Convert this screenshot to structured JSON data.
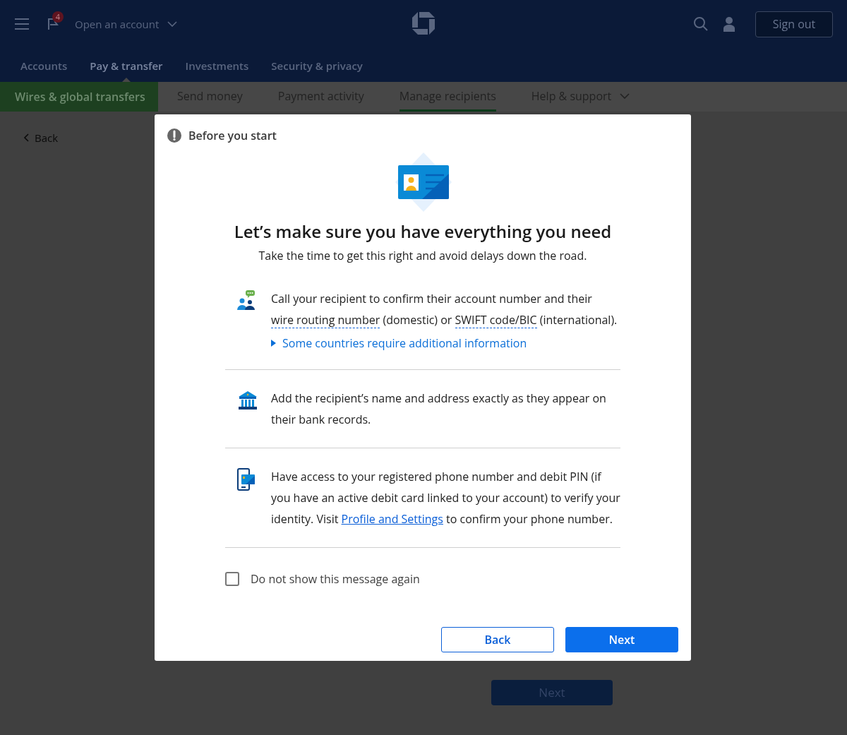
{
  "header": {
    "notification_count": "4",
    "open_account": "Open an account",
    "sign_out": "Sign out"
  },
  "main_nav": [
    {
      "label": "Accounts",
      "selected": false
    },
    {
      "label": "Pay & transfer",
      "selected": true
    },
    {
      "label": "Investments",
      "selected": false
    },
    {
      "label": "Security & privacy",
      "selected": false
    }
  ],
  "sub_nav": {
    "section": "Wires & global transfers",
    "items": [
      {
        "label": "Send money",
        "selected": false,
        "kind": "link"
      },
      {
        "label": "Payment activity",
        "selected": false,
        "kind": "link"
      },
      {
        "label": "Manage recipients",
        "selected": true,
        "kind": "link"
      },
      {
        "label": "Help & support",
        "selected": false,
        "kind": "menu"
      }
    ]
  },
  "back_link": "Back",
  "page_button": "Next",
  "dialog": {
    "title": "Before you start",
    "heading": "Let’s make sure you have everything you need",
    "subheading": "Take the time to get this right and avoid delays down the road.",
    "items": [
      {
        "kind": "people",
        "segments": [
          {
            "kind": "plain",
            "text": "Call your recipient to confirm their account number and their "
          },
          {
            "kind": "term",
            "text": "wire routing number"
          },
          {
            "kind": "plain",
            "text": " (domestic)  or "
          },
          {
            "kind": "term",
            "text": "SWIFT code/BIC"
          },
          {
            "kind": "plain",
            "text": " (international)."
          }
        ],
        "expander": {
          "label": "Some countries require additional information",
          "expanded": false
        }
      },
      {
        "kind": "bank",
        "segments": [
          {
            "kind": "plain",
            "text": "Add the recipient’s name and address exactly as they appear on their bank records."
          }
        ]
      },
      {
        "kind": "phone",
        "segments": [
          {
            "kind": "plain",
            "text": "Have access to your registered phone number and debit PIN (if you have an active debit card linked to your account) to verify your identity. Visit "
          },
          {
            "kind": "link",
            "text": "Profile and Settings"
          },
          {
            "kind": "plain",
            "text": " to confirm your phone number."
          }
        ]
      }
    ],
    "checkbox": {
      "label": "Do not show this message again",
      "checked": false
    },
    "buttons": [
      {
        "label": "Back",
        "kind": "secondary"
      },
      {
        "label": "Next",
        "kind": "primary"
      }
    ]
  }
}
